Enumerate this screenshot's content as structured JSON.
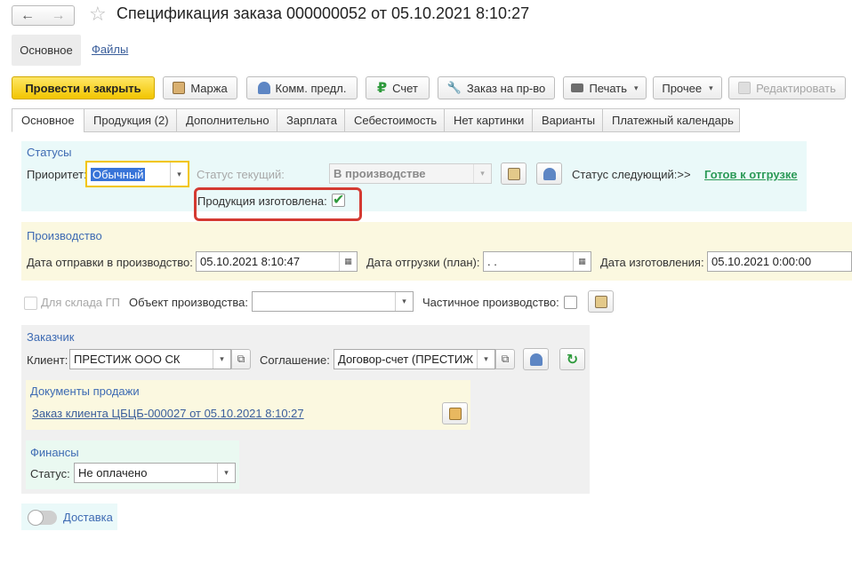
{
  "window": {
    "title": "Спецификация заказа 000000052 от 05.10.2021 8:10:27",
    "back_icon": "←",
    "forward_icon": "→",
    "star_icon": "☆"
  },
  "subnav": {
    "main": "Основное",
    "files": "Файлы"
  },
  "toolbar": {
    "post_close": "Провести и закрыть",
    "margin": "Маржа",
    "comm_offer": "Комм. предл.",
    "invoice": "Счет",
    "production_order": "Заказ на пр-во",
    "print": "Печать",
    "other": "Прочее",
    "edit": "Редактировать",
    "caret": "▾"
  },
  "tabs": [
    "Основное",
    "Продукция (2)",
    "Дополнительно",
    "Зарплата",
    "Себестоимость",
    "Нет картинки",
    "Варианты",
    "Платежный календарь"
  ],
  "statuses": {
    "title": "Статусы",
    "priority_label": "Приоритет:",
    "priority_value": "Обычный",
    "current_label": "Статус текущий:",
    "current_value": "В производстве",
    "next_label": "Статус следующий:>>",
    "next_value": "Готов к отгрузке",
    "made_label": "Продукция изготовлена:",
    "check_mark": "✔"
  },
  "production": {
    "title": "Производство",
    "sent_label": "Дата отправки в производство:",
    "sent_value": "05.10.2021  8:10:47",
    "ship_label": "Дата отгрузки (план):",
    "ship_value": " .  .",
    "made_label": "Дата изготовления:",
    "made_value": "05.10.2021  0:00:00"
  },
  "misc": {
    "warehouse_label": "Для склада ГП",
    "object_label": "Объект производства:",
    "object_value": "",
    "partial_label": "Частичное производство:"
  },
  "customer": {
    "title": "Заказчик",
    "client_label": "Клиент:",
    "client_value": "ПРЕСТИЖ ООО СК",
    "agreement_label": "Соглашение:",
    "agreement_value": "Договор-счет (ПРЕСТИЖ"
  },
  "sales_docs": {
    "title": "Документы продажи",
    "link": "Заказ клиента ЦБЦБ-000027 от 05.10.2021 8:10:27"
  },
  "finance": {
    "title": "Финансы",
    "status_label": "Статус:",
    "status_value": "Не оплачено"
  },
  "delivery": {
    "label": "Доставка"
  },
  "icons": {
    "open_icon": "⧉",
    "refresh_icon": "↻"
  },
  "colors": {
    "primary_button": "#f2c500",
    "accent_link": "#3a5e9b",
    "status_link": "#2c9a57",
    "highlight": "#d43a32"
  }
}
